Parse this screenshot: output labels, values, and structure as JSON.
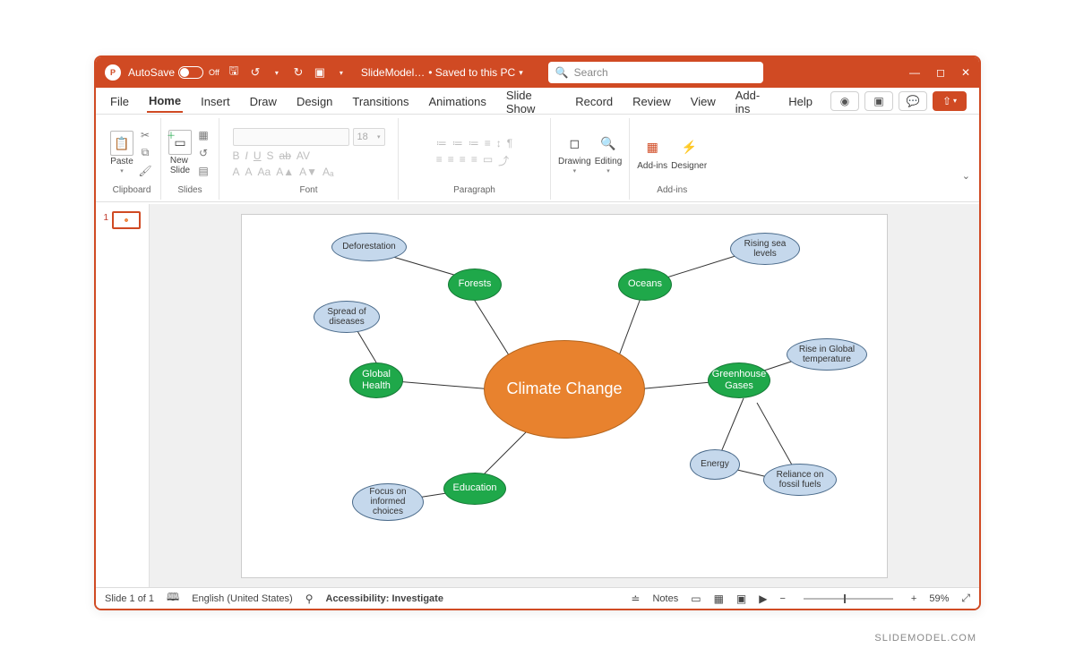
{
  "titlebar": {
    "autosave_label": "AutoSave",
    "autosave_state": "Off",
    "doc_name": "SlideModel…",
    "saved_state": "• Saved to this PC",
    "search_placeholder": "Search"
  },
  "tabs": {
    "items": [
      "File",
      "Home",
      "Insert",
      "Draw",
      "Design",
      "Transitions",
      "Animations",
      "Slide Show",
      "Record",
      "Review",
      "View",
      "Add-ins",
      "Help"
    ],
    "active_index": 1
  },
  "ribbon": {
    "clipboard": {
      "paste": "Paste",
      "label": "Clipboard"
    },
    "slides": {
      "new_slide": "New\nSlide",
      "label": "Slides"
    },
    "font": {
      "size": "18",
      "label": "Font",
      "row1": [
        "B",
        "I",
        "U",
        "S",
        "ab",
        "AV"
      ],
      "row2": [
        "A",
        "A",
        "Aa",
        "A▲",
        "A▼",
        "Aₐ"
      ]
    },
    "paragraph": {
      "label": "Paragraph",
      "row1": [
        "≔",
        "≔",
        "≔",
        "≡",
        "↕",
        "¶"
      ],
      "row2": [
        "≡",
        "≡",
        "≡",
        "≡",
        "▭",
        "⤴"
      ]
    },
    "drawing": {
      "btn": "Drawing",
      "editing": "Editing"
    },
    "addins": {
      "btn": "Add-ins",
      "designer": "Designer",
      "label": "Add-ins"
    }
  },
  "thumb": {
    "slides": [
      {
        "num": "1"
      }
    ]
  },
  "mindmap": {
    "center": "Climate Change",
    "nodes": {
      "forests": "Forests",
      "oceans": "Oceans",
      "global_health": "Global Health",
      "greenhouse": "Greenhouse Gases",
      "education": "Education",
      "energy": "Energy",
      "deforestation": "Deforestation",
      "rising_sea": "Rising sea levels",
      "spread": "Spread of diseases",
      "rise_temp": "Rise in Global temperature",
      "fossil": "Reliance on fossil fuels",
      "focus": "Focus on informed choices"
    }
  },
  "statusbar": {
    "slide_info": "Slide 1 of 1",
    "language": "English (United States)",
    "accessibility": "Accessibility: Investigate",
    "notes": "Notes",
    "zoom": "59%"
  },
  "watermark": "SLIDEMODEL.COM"
}
